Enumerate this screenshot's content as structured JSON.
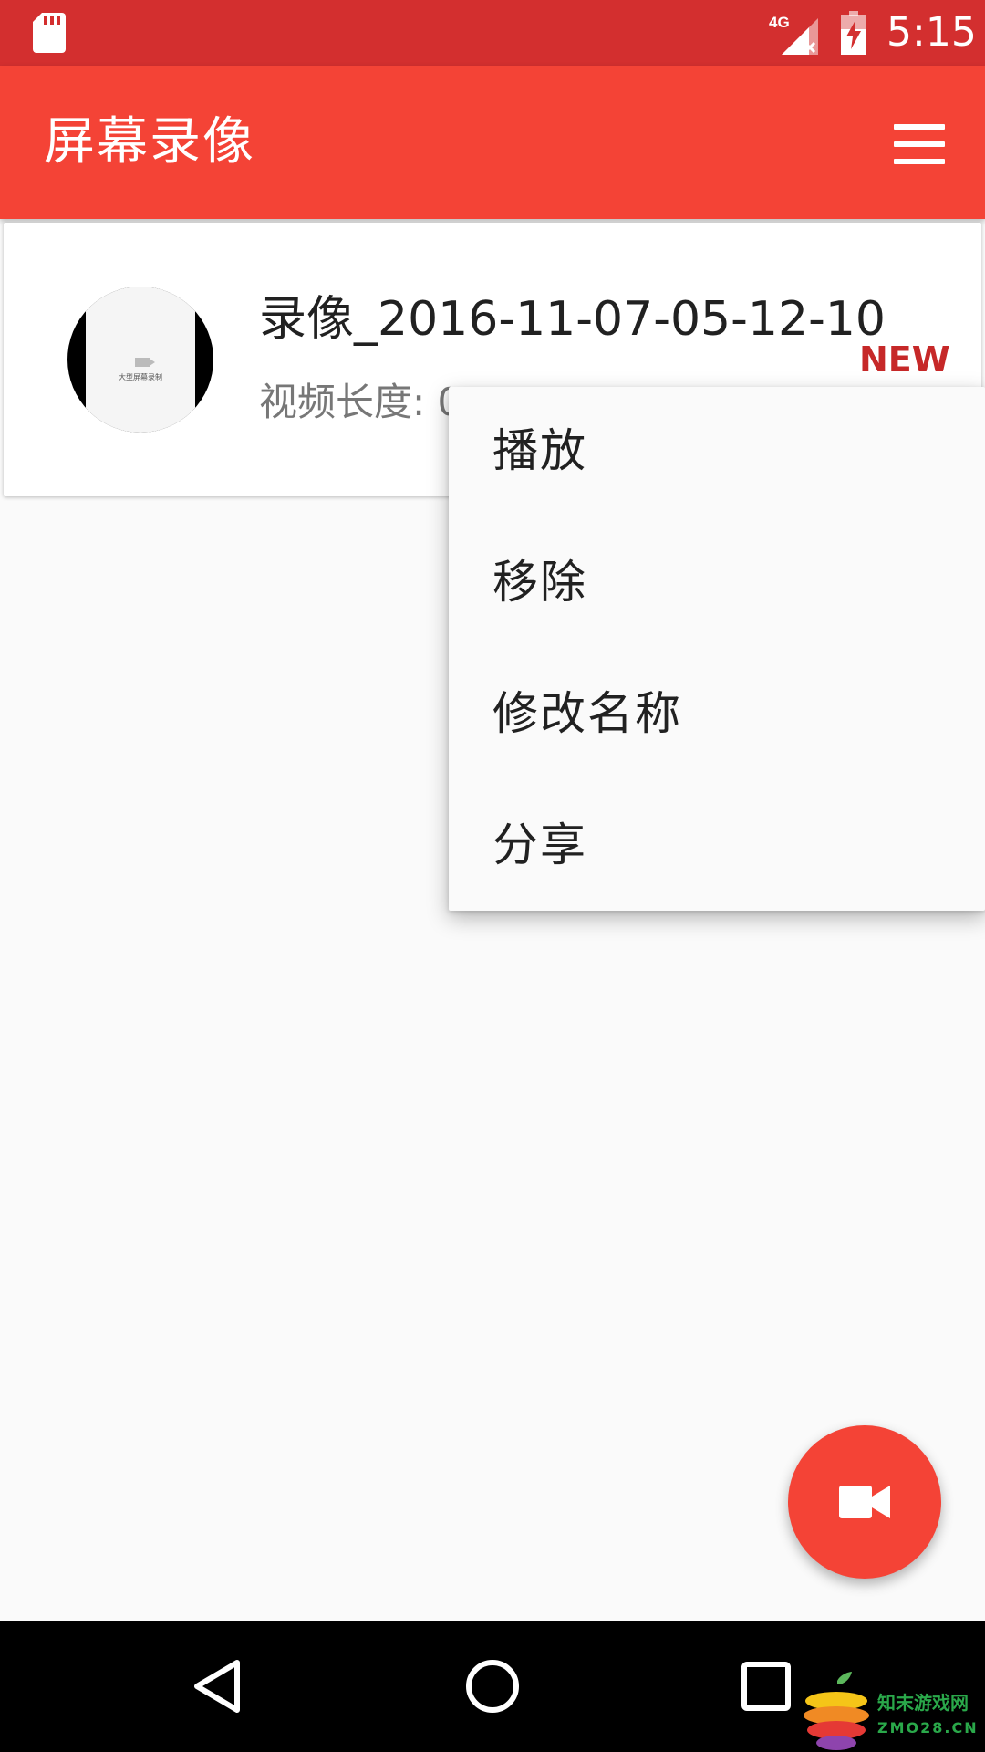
{
  "status_bar": {
    "network": "4G",
    "time": "5:15",
    "icons": [
      "sd-card-icon",
      "signal-icon",
      "battery-charging-icon"
    ]
  },
  "app_bar": {
    "title": "屏幕录像",
    "menu_icon": "hamburger-menu-icon"
  },
  "video_list": [
    {
      "name": "录像_2016-11-07-05-12-10",
      "duration_label": "视频长度: 0",
      "badge": "NEW",
      "thumbnail_caption": "大型屏幕录制"
    }
  ],
  "context_menu": {
    "items": [
      "播放",
      "移除",
      "修改名称",
      "分享"
    ]
  },
  "fab": {
    "icon": "videocam-icon"
  },
  "nav_bar": {
    "icons": [
      "back-triangle-icon",
      "home-circle-icon",
      "recents-square-icon"
    ]
  },
  "watermark": {
    "cn": "知末游戏网",
    "en": "ZMO28.CN"
  },
  "colors": {
    "status_bar": "#d32f2f",
    "app_bar": "#f44336",
    "accent": "#f44336",
    "badge": "#c62828",
    "background": "#fafafa"
  }
}
